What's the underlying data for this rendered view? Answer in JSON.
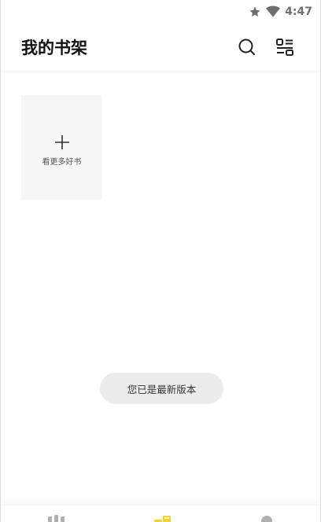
{
  "status_bar": {
    "time": "4:47",
    "icons": [
      "star-icon",
      "wifi-icon"
    ]
  },
  "header": {
    "title": "我的书架",
    "actions": [
      "search-icon",
      "list-icon"
    ]
  },
  "shelf": {
    "add_card": {
      "icon": "plus-icon",
      "label": "看更多好书"
    }
  },
  "toast": {
    "text": "您已是最新版本"
  },
  "bottom_nav": {
    "items": [
      "bookstore-icon",
      "bookshelf-icon",
      "profile-icon"
    ],
    "active_color": "#f2d22e"
  }
}
